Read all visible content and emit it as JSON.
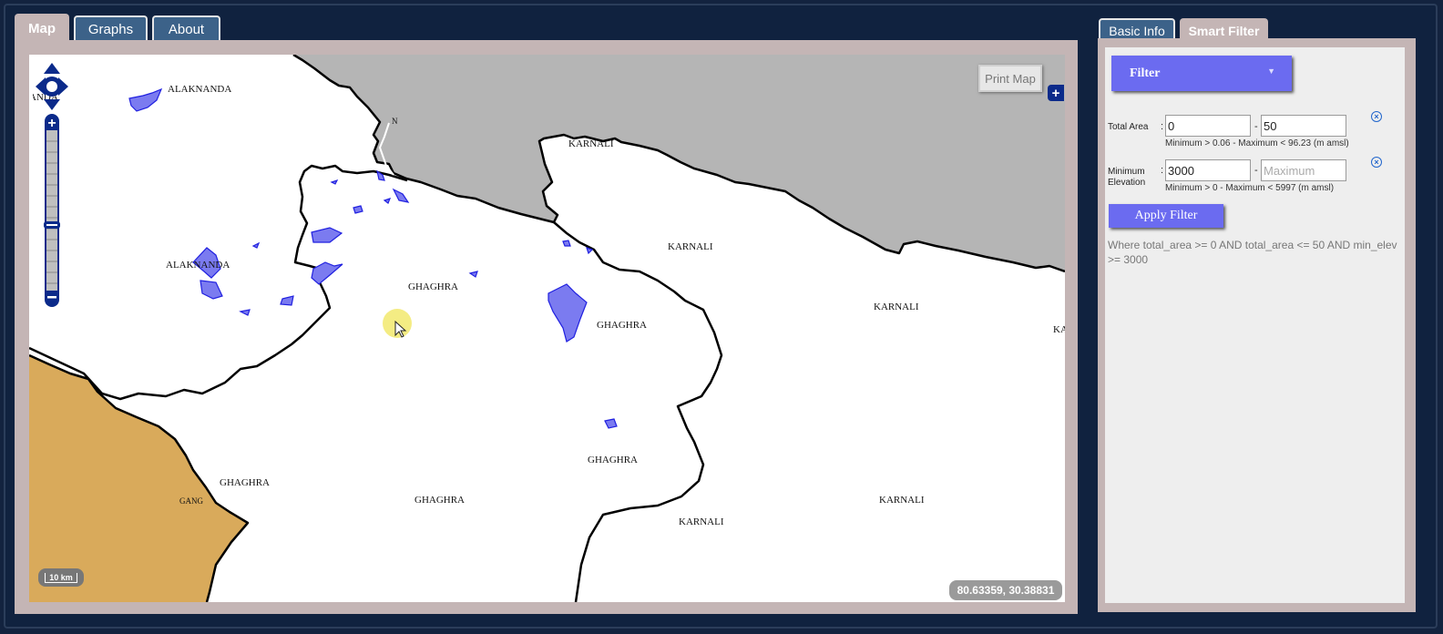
{
  "tabs": [
    {
      "label": "Map",
      "active": true
    },
    {
      "label": "Graphs",
      "active": false
    },
    {
      "label": "About",
      "active": false
    }
  ],
  "map": {
    "print_label": "Print Map",
    "layer_switch_icon": "plus-icon",
    "coordinates": "80.63359, 30.38831",
    "scale": "10 km",
    "colors": {
      "tibet": "#b5b5b5",
      "india": "#d9aa5b",
      "glacier": "#3535e8",
      "glacier_fill": "#7b7bf0"
    },
    "labels": [
      {
        "key": "alaknanda-1",
        "text": "ALAKNANDA"
      },
      {
        "key": "and-partial",
        "text": "ANDA"
      },
      {
        "key": "alaknanda-2",
        "text": "ALAKNANDA"
      },
      {
        "key": "karnali-top",
        "text": "KARNALI"
      },
      {
        "key": "karnali-2",
        "text": "KARNALI"
      },
      {
        "key": "karnali-3",
        "text": "KARNALI"
      },
      {
        "key": "karnali-4",
        "text": "KARNALI"
      },
      {
        "key": "karnali-5",
        "text": "KARNALI"
      },
      {
        "key": "ka-partial",
        "text": "KA"
      },
      {
        "key": "ghaghra-1",
        "text": "GHAGHRA"
      },
      {
        "key": "ghaghra-2",
        "text": "GHAGHRA"
      },
      {
        "key": "ghaghra-3",
        "text": "GHAGHRA"
      },
      {
        "key": "ghaghra-4",
        "text": "GHAGHRA"
      },
      {
        "key": "ghaghra-5",
        "text": "GHAGHRA"
      },
      {
        "key": "ganga-partial",
        "text": "GANG"
      },
      {
        "key": "n-partial",
        "text": "N"
      }
    ]
  },
  "side_tabs": [
    {
      "label": "Basic Info",
      "active": false
    },
    {
      "label": "Smart Filter",
      "active": true
    }
  ],
  "filter": {
    "dropdown_label": "Filter",
    "total_area": {
      "label": "Total Area",
      "min_value": "0",
      "max_value": "50",
      "hint": "Minimum > 0.06 - Maximum < 96.23 (m amsl)"
    },
    "min_elevation": {
      "label_line1": "Minimum",
      "label_line2": "Elevation",
      "min_value": "3000",
      "max_placeholder": "Maximum",
      "hint": "Minimum > 0 - Maximum < 5997 (m amsl)"
    },
    "colon": ":",
    "dash": "-",
    "apply_label": "Apply Filter",
    "where_clause": "Where total_area >= 0 AND total_area <= 50 AND min_elev >= 3000"
  }
}
